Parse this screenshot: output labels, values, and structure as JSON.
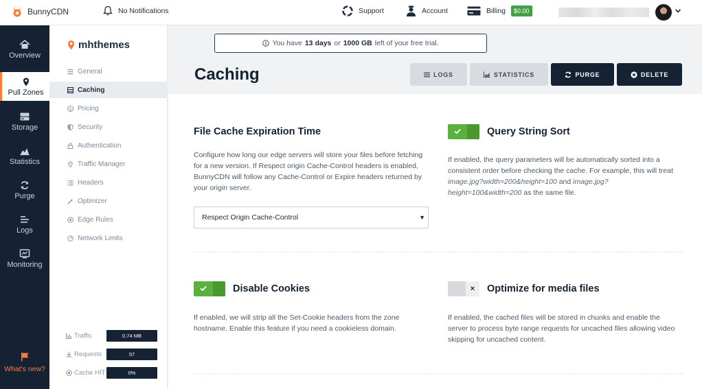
{
  "brand": {
    "name": "BunnyCDN",
    "accent": "#ff7b37",
    "dark": "#142233",
    "success": "#5cb03e"
  },
  "topbar": {
    "notifications": "No Notifications",
    "support": "Support",
    "account": "Account",
    "billing": "Billing",
    "balance": "$0.00"
  },
  "sidebar": {
    "items": [
      {
        "label": "Overview",
        "icon": "home-icon"
      },
      {
        "label": "Pull Zones",
        "icon": "location-pin-icon"
      },
      {
        "label": "Storage",
        "icon": "storage-icon"
      },
      {
        "label": "Statistics",
        "icon": "chart-icon"
      },
      {
        "label": "Purge",
        "icon": "refresh-icon"
      },
      {
        "label": "Logs",
        "icon": "list-icon"
      },
      {
        "label": "Monitoring",
        "icon": "monitor-icon"
      }
    ],
    "active": "Pull Zones",
    "whats_new": "What's new?"
  },
  "zone": {
    "name": "mhthemes",
    "links": [
      {
        "label": "General",
        "icon": "list-icon"
      },
      {
        "label": "Caching",
        "icon": "cache-icon"
      },
      {
        "label": "Pricing",
        "icon": "dollar-icon"
      },
      {
        "label": "Security",
        "icon": "shield-icon"
      },
      {
        "label": "Authentication",
        "icon": "lock-icon"
      },
      {
        "label": "Traffic Manager",
        "icon": "pin-icon"
      },
      {
        "label": "Headers",
        "icon": "headers-icon"
      },
      {
        "label": "Optimizer",
        "icon": "wand-icon"
      },
      {
        "label": "Edge Rules",
        "icon": "target-icon"
      },
      {
        "label": "Network Limits",
        "icon": "gauge-icon"
      }
    ],
    "active": "Caching",
    "stats": [
      {
        "label": "Traffic",
        "value": "0.74 MB"
      },
      {
        "label": "Requests",
        "value": "57"
      },
      {
        "label": "Cache HIT",
        "value": "0%"
      }
    ]
  },
  "trial": {
    "prefix": "You have",
    "days": "13 days",
    "or": "or",
    "gb": "1000 GB",
    "suffix": "left of your free trial."
  },
  "page": {
    "title": "Caching",
    "buttons": {
      "logs": "LOGS",
      "statistics": "STATISTICS",
      "purge": "PURGE",
      "delete": "DELETE"
    }
  },
  "settings": {
    "expiration": {
      "title": "File Cache Expiration Time",
      "description": "Configure how long our edge servers will store your files before fetching for a new version. If Respect origin Cache-Control headers is enabled, BunnyCDN will follow any Cache-Control or Expire headers returned by your origin server.",
      "selected": "Respect Origin Cache-Control"
    },
    "query_sort": {
      "title": "Query String Sort",
      "enabled": true,
      "desc_before": "If enabled, the query parameters will be automatically sorted into a consistent order before checking the cache. For example, this will treat",
      "example1": "image.jpg?width=200&height=100",
      "and": "and",
      "example2": "image.jpg?height=100&width=200",
      "desc_after": "as the same file."
    },
    "cookies": {
      "title": "Disable Cookies",
      "enabled": true,
      "description": "If enabled, we will strip all the Set-Cookie headers from the zone hostname. Enable this feature if you need a cookieless domain."
    },
    "media": {
      "title": "Optimize for media files",
      "enabled": false,
      "off_symbol": "×",
      "description": "If enabled, the cached files will be stored in chunks and enable the server to process byte range requests for uncached files allowing video skipping for uncached content."
    }
  }
}
